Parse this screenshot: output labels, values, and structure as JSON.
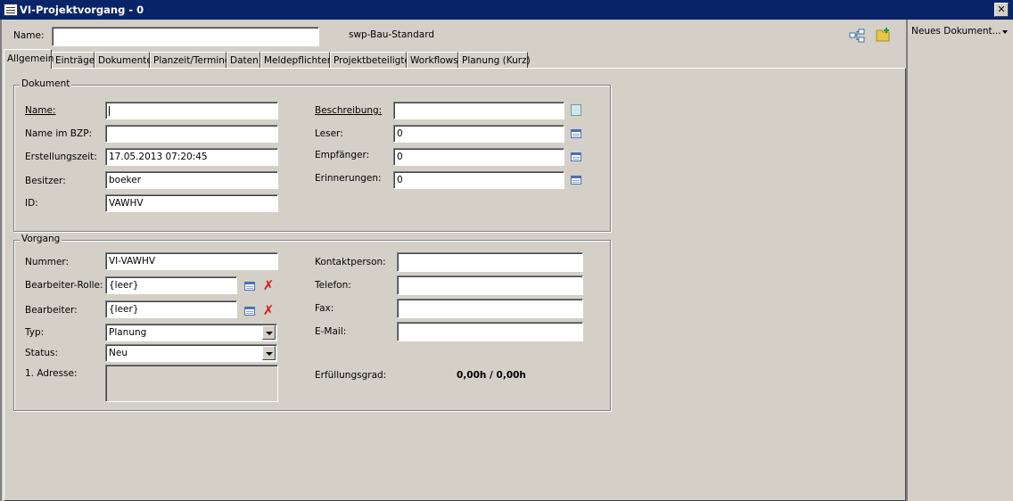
{
  "window": {
    "title": "VI-Projektvorgang - 0",
    "close_label": "✕"
  },
  "header": {
    "name_label": "Name:",
    "name_value": "",
    "template": "swp-Bau-Standard"
  },
  "tabs": [
    {
      "label": "Allgemein",
      "active": true
    },
    {
      "label": "Einträge"
    },
    {
      "label": "Dokumente"
    },
    {
      "label": "Planzeit/Termine"
    },
    {
      "label": "Daten"
    },
    {
      "label": "Meldepflichten"
    },
    {
      "label": "Projektbeteiligte"
    },
    {
      "label": "Workflows"
    },
    {
      "label": "Planung (Kurz)"
    }
  ],
  "dokument": {
    "legend": "Dokument",
    "name_label": "Name:",
    "name_value": "",
    "name_bzp_label": "Name im BZP:",
    "name_bzp_value": "",
    "erstellungszeit_label": "Erstellungszeit:",
    "erstellungszeit_value": "17.05.2013 07:20:45",
    "besitzer_label": "Besitzer:",
    "besitzer_value": "boeker",
    "id_label": "ID:",
    "id_value": "VAWHV",
    "beschreibung_label": "Beschreibung:",
    "beschreibung_value": "",
    "leser_label": "Leser:",
    "leser_value": "0",
    "empfaenger_label": "Empfänger:",
    "empfaenger_value": "0",
    "erinnerungen_label": "Erinnerungen:",
    "erinnerungen_value": "0"
  },
  "vorgang": {
    "legend": "Vorgang",
    "nummer_label": "Nummer:",
    "nummer_value": "VI-VAWHV",
    "rolle_label": "Bearbeiter-Rolle:",
    "rolle_value": "{leer}",
    "bearbeiter_label": "Bearbeiter:",
    "bearbeiter_value": "{leer}",
    "typ_label": "Typ:",
    "typ_value": "Planung",
    "status_label": "Status:",
    "status_value": "Neu",
    "adresse_label": "1. Adresse:",
    "kontakt_label": "Kontaktperson:",
    "kontakt_value": "",
    "telefon_label": "Telefon:",
    "telefon_value": "",
    "fax_label": "Fax:",
    "fax_value": "",
    "email_label": "E-Mail:",
    "email_value": "",
    "erfuellung_label": "Erfüllungsgrad:",
    "erfuellung_value": "0,00h / 0,00h"
  },
  "right_panel": {
    "new_document_label": "Neues Dokument..."
  },
  "icons": {
    "window": "window-icon",
    "net": "hierarchy-icon",
    "folder": "folder-add-icon",
    "lookup": "list-lookup-icon",
    "note": "note-icon",
    "delete": "delete-x-icon"
  }
}
